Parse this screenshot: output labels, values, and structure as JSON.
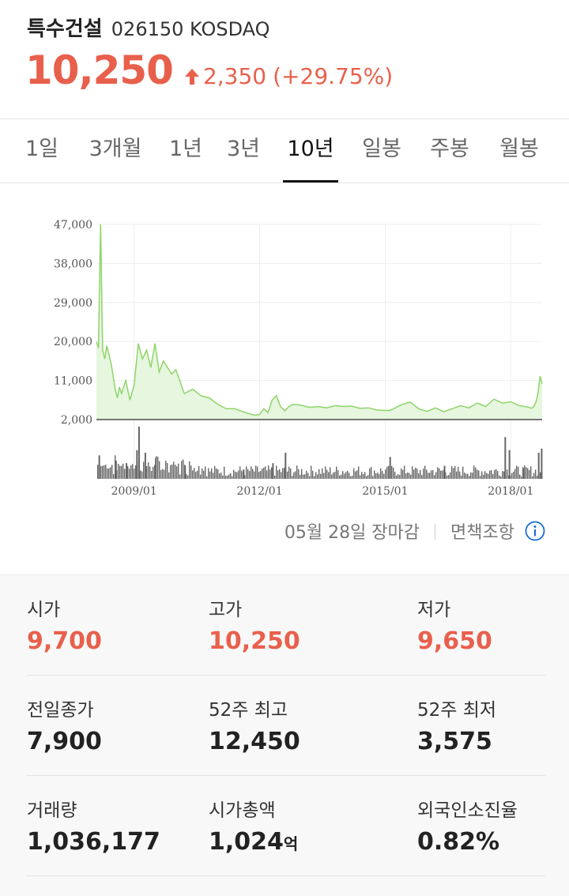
{
  "header": {
    "name": "특수건설",
    "code": "026150 KOSDAQ",
    "price": "10,250",
    "change": "2,350",
    "change_pct": "(+29.75%)",
    "accent_color": "#e8604c"
  },
  "tabs": [
    {
      "label": "1일",
      "active": false
    },
    {
      "label": "3개월",
      "active": false
    },
    {
      "label": "1년",
      "active": false
    },
    {
      "label": "3년",
      "active": false
    },
    {
      "label": "10년",
      "active": true
    },
    {
      "label": "일봉",
      "active": false
    },
    {
      "label": "주봉",
      "active": false
    },
    {
      "label": "월봉",
      "active": false
    }
  ],
  "chart_data": {
    "type": "area",
    "y_tick_labels": [
      "47,000",
      "38,000",
      "29,000",
      "20,000",
      "11,000",
      "2,000"
    ],
    "ylim": [
      2000,
      47000
    ],
    "x_tick_labels": [
      "2009/01",
      "2012/01",
      "2015/01",
      "2018/01"
    ],
    "xlim": [
      2008.1,
      2018.75
    ],
    "grid": true,
    "line_color": "#8fd46a",
    "fill_color": "#e6f6df",
    "volume_color": "#666666",
    "price_series": {
      "x": [
        2008.1,
        2008.15,
        2008.2,
        2008.25,
        2008.3,
        2008.35,
        2008.4,
        2008.45,
        2008.5,
        2008.55,
        2008.6,
        2008.65,
        2008.7,
        2008.8,
        2008.9,
        2009.0,
        2009.1,
        2009.2,
        2009.3,
        2009.4,
        2009.5,
        2009.6,
        2009.7,
        2009.8,
        2009.9,
        2010.0,
        2010.2,
        2010.4,
        2010.6,
        2010.8,
        2011.0,
        2011.2,
        2011.4,
        2011.6,
        2011.8,
        2011.9,
        2012.0,
        2012.1,
        2012.2,
        2012.3,
        2012.4,
        2012.5,
        2012.6,
        2012.7,
        2012.8,
        2013.0,
        2013.2,
        2013.4,
        2013.6,
        2013.8,
        2014.0,
        2014.2,
        2014.4,
        2014.6,
        2014.8,
        2015.0,
        2015.1,
        2015.2,
        2015.4,
        2015.6,
        2015.8,
        2016.0,
        2016.2,
        2016.4,
        2016.6,
        2016.8,
        2017.0,
        2017.2,
        2017.4,
        2017.6,
        2017.8,
        2018.0,
        2018.2,
        2018.4,
        2018.5,
        2018.55,
        2018.6,
        2018.65,
        2018.7,
        2018.75
      ],
      "values": [
        20000,
        18500,
        47000,
        18000,
        16000,
        19000,
        17000,
        15000,
        12000,
        9000,
        7000,
        9500,
        8000,
        11000,
        6500,
        10000,
        19500,
        16000,
        18000,
        14000,
        19500,
        13000,
        15500,
        14000,
        12500,
        13500,
        8000,
        9000,
        7500,
        7000,
        5500,
        4500,
        4500,
        3800,
        3200,
        3000,
        3200,
        4500,
        3600,
        6500,
        7500,
        5000,
        4000,
        5000,
        5500,
        5300,
        4800,
        5000,
        4700,
        5200,
        5000,
        5100,
        4600,
        4700,
        4200,
        4100,
        4100,
        4500,
        5500,
        6000,
        4500,
        3900,
        4700,
        3800,
        4500,
        5200,
        4700,
        5800,
        5000,
        6700,
        5800,
        6100,
        5200,
        4900,
        4600,
        5000,
        6000,
        8000,
        12000,
        10250
      ]
    },
    "volume_series": {
      "x": [
        2008.15,
        2008.55,
        2008.8,
        2009.05,
        2009.1,
        2009.25,
        2009.5,
        2010.2,
        2011.6,
        2012.3,
        2012.6,
        2015.1,
        2016.4,
        2017.85,
        2017.95,
        2018.3,
        2018.65,
        2018.72
      ],
      "values": [
        0.45,
        0.35,
        0.3,
        0.55,
        1.0,
        0.5,
        0.4,
        0.25,
        0.18,
        0.3,
        0.5,
        0.42,
        0.25,
        0.8,
        0.55,
        0.2,
        0.5,
        0.58
      ]
    }
  },
  "chart_footer": {
    "market_status": "05월 28일 장마감",
    "disclaimer": "면책조항"
  },
  "stats": {
    "open": {
      "label": "시가",
      "value": "9,700"
    },
    "high": {
      "label": "고가",
      "value": "10,250"
    },
    "low": {
      "label": "저가",
      "value": "9,650"
    },
    "prev_close": {
      "label": "전일종가",
      "value": "7,900"
    },
    "high52": {
      "label": "52주 최고",
      "value": "12,450"
    },
    "low52": {
      "label": "52주 최저",
      "value": "3,575"
    },
    "volume": {
      "label": "거래량",
      "value": "1,036,177"
    },
    "market_cap": {
      "label": "시가총액",
      "value": "1,024",
      "unit": "억"
    },
    "foreign_ratio": {
      "label": "외국인소진율",
      "value": "0.82%"
    }
  }
}
